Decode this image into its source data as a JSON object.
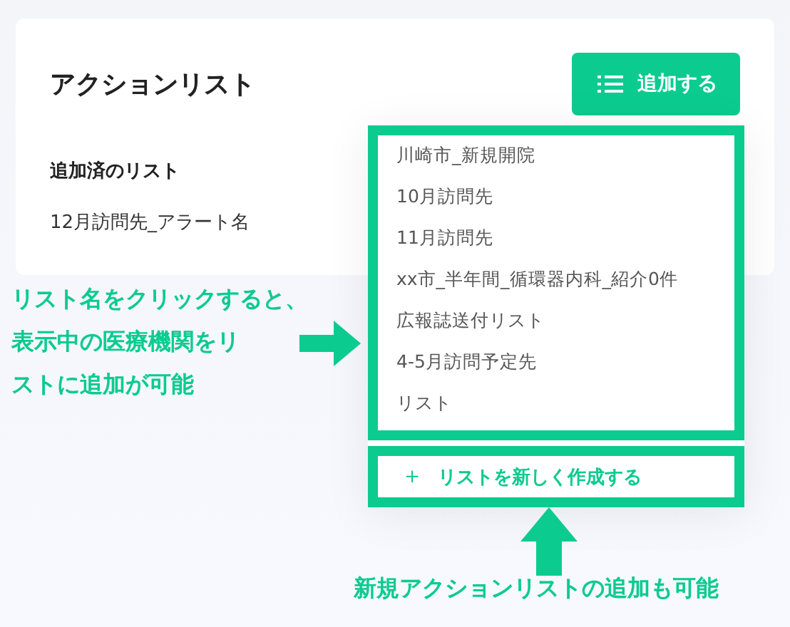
{
  "card": {
    "title": "アクションリスト",
    "add_button": "追加する",
    "added_label": "追加済のリスト",
    "added_items": [
      "12月訪問先_アラート名"
    ]
  },
  "dropdown": {
    "items": [
      "川崎市_新規開院",
      "10月訪問先",
      "11月訪問先",
      "xx市_半年間_循環器内科_紹介0件",
      "広報誌送付リスト",
      "4-5月訪問予定先",
      "リスト"
    ],
    "create_button": "＋",
    "create_label": "リストを新しく作成する"
  },
  "annotations": [
    {
      "kind": "left",
      "lines": [
        "リスト名をクリックすると、",
        "表示中の医療機関をリ",
        "ストに追加が可能"
      ]
    },
    {
      "kind": "bottom",
      "lines": [
        "新規アクションリストの追加も可能"
      ]
    }
  ]
}
